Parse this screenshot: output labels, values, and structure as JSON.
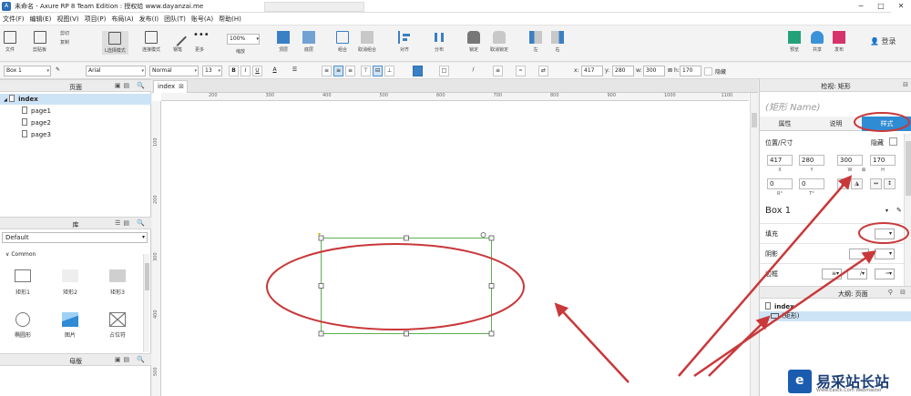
{
  "window": {
    "title": "未命名 - Axure RP 8 Team Edition : 授权给 www.dayanzai.me",
    "controls": [
      "minimize-icon",
      "maximize-icon",
      "close-icon"
    ]
  },
  "menu": {
    "items": [
      "文件(F)",
      "编辑(E)",
      "视图(V)",
      "项目(P)",
      "布局(A)",
      "发布(I)",
      "团队(T)",
      "账号(A)",
      "帮助(H)"
    ]
  },
  "toolbar": {
    "file_label": "文件",
    "clipboard_label": "剪贴板",
    "cut_label": "剪切",
    "copy_label": "复制",
    "select_mode_label": "L选择模式",
    "connect_label": "连接模式",
    "pen_label": "钢笔",
    "more_label": "更多",
    "zoom_value": "100%",
    "zoom_label": "缩放",
    "top_label": "顶层",
    "bottom_label": "底层",
    "group_label": "组合",
    "ungroup_label": "取消组合",
    "align_label": "对齐",
    "distribute_label": "分布",
    "lock_label": "锁定",
    "unlock_label": "取消锁定",
    "left_label": "左",
    "right_label": "右",
    "preview_label": "预览",
    "share_label": "共享",
    "publish_label": "发布",
    "login_label": "登录"
  },
  "format_bar": {
    "widget_name": "Box 1",
    "font": "Arial",
    "style": "Normal",
    "size": "13",
    "bold": "B",
    "italic": "I",
    "underline": "U",
    "x_label": "x:",
    "x_value": "417",
    "y_label": "y:",
    "y_value": "280",
    "w_label": "w:",
    "w_value": "300",
    "h_label": "h:",
    "h_value": "170",
    "hidden_label": "隐藏"
  },
  "left_panel": {
    "pages_title": "页面",
    "pages": [
      {
        "name": "index",
        "selected": true
      },
      {
        "name": "page1",
        "selected": false
      },
      {
        "name": "page2",
        "selected": false
      },
      {
        "name": "page3",
        "selected": false
      }
    ],
    "library_title": "库",
    "library_select": "Default",
    "library_group": "Common",
    "widgets": [
      "矩形1",
      "矩形2",
      "矩形3",
      "椭圆形",
      "图片",
      "占位符"
    ],
    "masters_title": "母版"
  },
  "canvas": {
    "tab_label": "index",
    "ruler_top": [
      "200",
      "300",
      "400",
      "500",
      "600",
      "700",
      "800",
      "900",
      "1000",
      "1100"
    ],
    "ruler_left": [
      "100",
      "200",
      "300",
      "400",
      "500"
    ]
  },
  "inspector": {
    "title": "检视: 矩形",
    "name_placeholder": "(矩形 Name)",
    "tabs": [
      "属性",
      "说明",
      "样式"
    ],
    "active_tab": "样式",
    "size_section": "位置/尺寸",
    "hidden_label": "隐藏",
    "x": "417",
    "y": "280",
    "w": "300",
    "h": "170",
    "x_label": "X",
    "y_label": "Y",
    "w_label": "W",
    "h_label": "H",
    "rotation": "0",
    "text_rotation": "0",
    "r_label": "R°",
    "t_label": "T°",
    "style_name": "Box 1",
    "fill_label": "填充",
    "shadow_label": "阴影",
    "border_label": "边框",
    "outline_title": "大纲: 页面",
    "outline_page": "index",
    "outline_item": "(矩形)"
  },
  "watermark": {
    "brand": "易采站长站",
    "url": "Www.Easck.Com Webmaster",
    "logo_letter": "e"
  },
  "colors": {
    "accent": "#2f8bd4",
    "annotation_red": "#c9383a",
    "selection_green": "#5bb14f"
  }
}
